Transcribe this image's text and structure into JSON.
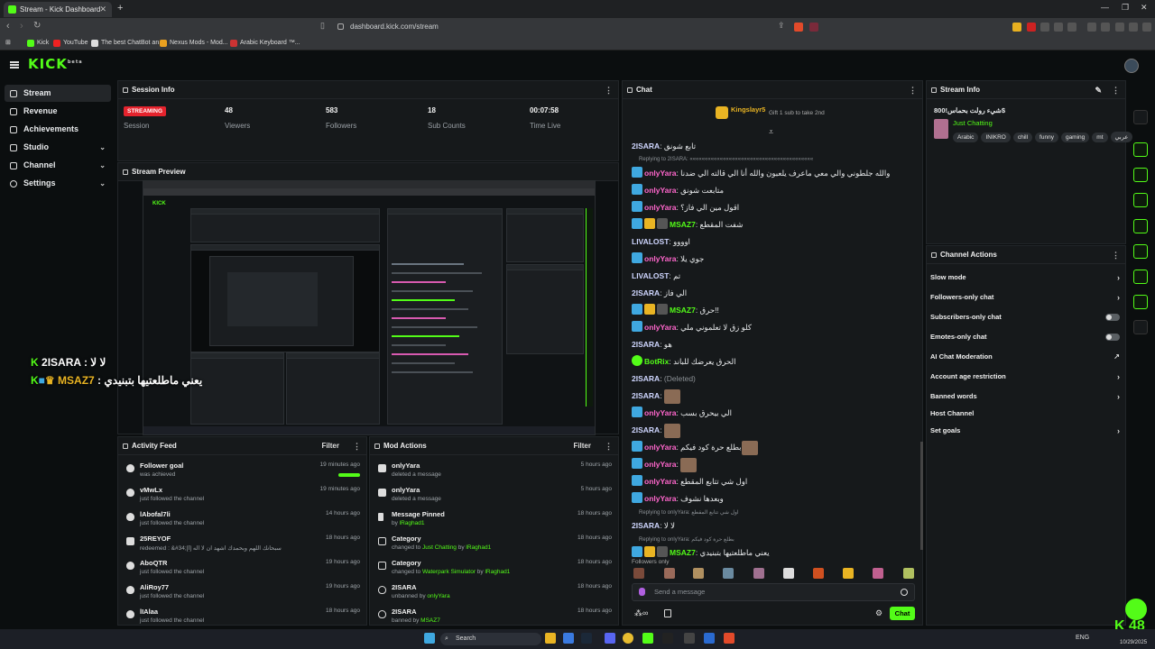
{
  "browser": {
    "tab_title": "Stream - Kick Dashboard",
    "new_tab": "+",
    "url": "dashboard.kick.com/stream",
    "bookmarks": [
      "Kick",
      "YouTube",
      "The best ChatBot an...",
      "Nexus Mods - Mod...",
      "Arabic Keyboard ™..."
    ]
  },
  "app": {
    "logo": "KICK",
    "logo_sup": "beta"
  },
  "sidebar": {
    "items": [
      {
        "label": "Stream"
      },
      {
        "label": "Revenue"
      },
      {
        "label": "Achievements"
      },
      {
        "label": "Studio"
      },
      {
        "label": "Channel"
      },
      {
        "label": "Settings"
      }
    ]
  },
  "session": {
    "title": "Session Info",
    "status": "STREAMING",
    "status_label": "Session",
    "viewers": "48",
    "viewers_label": "Viewers",
    "followers": "583",
    "followers_label": "Followers",
    "subs": "18",
    "subs_label": "Sub Counts",
    "time": "00:07:58",
    "time_label": "Time Live"
  },
  "preview": {
    "title": "Stream Preview",
    "overlay1_user": "2ISARA",
    "overlay1_msg": ": لا لا",
    "overlay2_user": "MSAZ7",
    "overlay2_msg": ": يعني ماطلعتيها بتبنيدي"
  },
  "activity": {
    "title": "Activity Feed",
    "filter": "Filter",
    "rows": [
      {
        "name": "Follower goal",
        "sub": "was achieved",
        "time": "19 minutes ago"
      },
      {
        "name": "vMwLx",
        "sub": "just followed the channel",
        "time": "19 minutes ago"
      },
      {
        "name": "lAbofal7li",
        "sub": "just followed the channel",
        "time": "14 hours ago"
      },
      {
        "name": "25REYOF",
        "sub": "redeemed : &#34;[ا] سبحانك اللهم وبحمدك اشهد ان لا اله",
        "time": "18 hours ago"
      },
      {
        "name": "AboQTR",
        "sub": "just followed the channel",
        "time": "19 hours ago"
      },
      {
        "name": "AliRoy77",
        "sub": "just followed the channel",
        "time": "19 hours ago"
      },
      {
        "name": "lIAlaa",
        "sub": "just followed the channel",
        "time": "18 hours ago"
      }
    ]
  },
  "mod": {
    "title": "Mod Actions",
    "filter": "Filter",
    "rows": [
      {
        "name": "onlyYara",
        "sub": "deleted a message",
        "time": "5 hours ago"
      },
      {
        "name": "onlyYara",
        "sub": "deleted a message",
        "time": "5 hours ago"
      },
      {
        "name": "Message Pinned",
        "sub": "by ",
        "by": "lRaghad1",
        "time": "18 hours ago"
      },
      {
        "name": "Category",
        "sub": "changed to ",
        "cat": "Just Chatting",
        "by_pre": " by ",
        "by": "lRaghad1",
        "time": "18 hours ago"
      },
      {
        "name": "Category",
        "sub": "changed to ",
        "cat": "Waterpark Simulator",
        "by_pre": " by ",
        "by": "lRaghad1",
        "time": "18 hours ago"
      },
      {
        "name": "2ISARA",
        "sub": "unbanned by ",
        "by": "onlyYara",
        "time": "18 hours ago"
      },
      {
        "name": "2ISARA",
        "sub": "banned by ",
        "by": "MSAZ7",
        "time": "18 hours ago"
      }
    ]
  },
  "chat": {
    "title": "Chat",
    "pinned_user": "Kingslayr5",
    "pinned_text": "Gift 1 sub to take 2nd",
    "messages": [
      {
        "user": "2ISARA",
        "color": "#cfd6ff",
        "text": "تابع شونق"
      },
      {
        "reply": "Replying to 2ISARA: «««««««««««««««««««««««««««««««««««««««««"
      },
      {
        "user": "onlyYara",
        "color": "#ff66cc",
        "text": "والله جلطوني والي معي ماعرف يلعبون والله أنا الي قالته الي ضدنا"
      },
      {
        "user": "onlyYara",
        "color": "#ff66cc",
        "text": "متابعت شونق"
      },
      {
        "user": "onlyYara",
        "color": "#ff66cc",
        "text": "اقول مين الي فاز؟"
      },
      {
        "user": "MSAZ7",
        "color": "#53fc18",
        "text": "شفت المقطع"
      },
      {
        "user": "LIVALOST",
        "color": "#cfd6ff",
        "text": "اوووو"
      },
      {
        "user": "onlyYara",
        "color": "#ff66cc",
        "text": "جوي يلا"
      },
      {
        "user": "LIVALOST",
        "color": "#cfd6ff",
        "text": "تم"
      },
      {
        "user": "2ISARA",
        "color": "#cfd6ff",
        "text": "الي فاز"
      },
      {
        "user": "MSAZ7",
        "color": "#53fc18",
        "text": "حرق!!"
      },
      {
        "user": "onlyYara",
        "color": "#ff66cc",
        "text": "كلو زق لا تعلموني ملي"
      },
      {
        "user": "2ISARA",
        "color": "#cfd6ff",
        "text": "هو"
      },
      {
        "user": "BotRix",
        "color": "#53fc18",
        "text": "الحرق يعرضك للباند"
      },
      {
        "user": "2ISARA",
        "color": "#cfd6ff",
        "text": "(Deleted)"
      },
      {
        "user": "2ISARA",
        "color": "#cfd6ff",
        "text": ""
      },
      {
        "user": "onlyYara",
        "color": "#ff66cc",
        "text": "الي بيحرق بسب"
      },
      {
        "user": "2ISARA",
        "color": "#cfd6ff",
        "text": ""
      },
      {
        "user": "onlyYara",
        "color": "#ff66cc",
        "text": "بطلع حرة كود فيكم"
      },
      {
        "user": "onlyYara",
        "color": "#ff66cc",
        "text": ""
      },
      {
        "user": "onlyYara",
        "color": "#ff66cc",
        "text": "اول شي تتابع المقطع"
      },
      {
        "user": "onlyYara",
        "color": "#ff66cc",
        "text": "وبعدها نشوف"
      },
      {
        "reply": "Replying to onlyYara: اول شي تتابع المقطع"
      },
      {
        "user": "2ISARA",
        "color": "#cfd6ff",
        "text": "لا لا"
      },
      {
        "reply": "Replying to onlyYara: بطلع حرة كود فيكم"
      },
      {
        "user": "MSAZ7",
        "color": "#53fc18",
        "text": "يعني ماطلعتيها بتبنيدي"
      }
    ],
    "followers_only": "Followers only",
    "placeholder": "Send a message",
    "chat_btn": "Chat"
  },
  "stream_info": {
    "title": "Stream Info",
    "stream_title": "شيء رولت بحماس!800$",
    "category": "Just Chatting",
    "tags": [
      "Arabic",
      "INIKRO",
      "chill",
      "funny",
      "gaming",
      "mt",
      "عربي"
    ]
  },
  "channel_actions": {
    "title": "Channel Actions",
    "rows": [
      {
        "label": "Slow mode"
      },
      {
        "label": "Followers-only chat"
      },
      {
        "label": "Subscribers-only chat"
      },
      {
        "label": "Emotes-only chat"
      },
      {
        "label": "AI Chat Moderation"
      },
      {
        "label": "Account age restriction"
      },
      {
        "label": "Banned words"
      },
      {
        "label": "Host Channel"
      },
      {
        "label": "Set goals"
      }
    ]
  },
  "corner": {
    "viewers": "48"
  },
  "taskbar": {
    "search": "Search",
    "lang": "ENG",
    "date": "10/29/2025"
  }
}
